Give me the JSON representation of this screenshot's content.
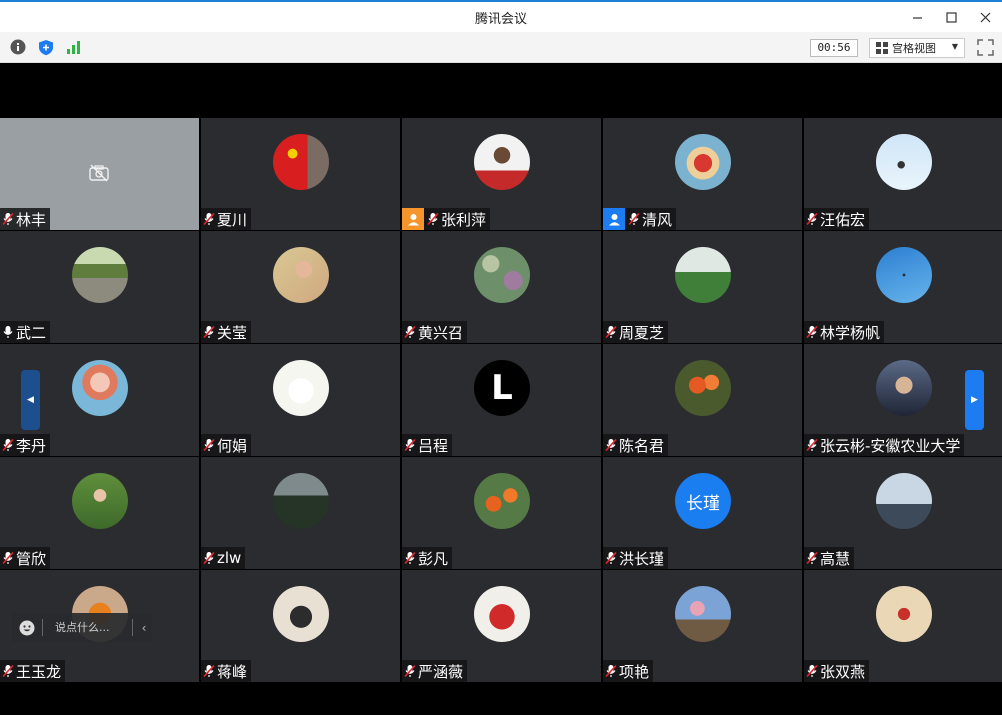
{
  "window": {
    "title": "腾讯会议"
  },
  "toolbar": {
    "icons": [
      "info-icon",
      "shield-icon",
      "signal-icon"
    ],
    "timer": "00:56",
    "view_label": "宫格视图"
  },
  "chat": {
    "placeholder": "说点什么..."
  },
  "participants": [
    {
      "name": "林丰",
      "camera_off": true,
      "mic": "muted"
    },
    {
      "name": "夏川",
      "mic": "muted"
    },
    {
      "name": "张利萍",
      "mic": "muted",
      "badge": "host"
    },
    {
      "name": "清风",
      "mic": "muted",
      "badge": "cohost"
    },
    {
      "name": "汪佑宏",
      "mic": "muted"
    },
    {
      "name": "武二",
      "mic": "on"
    },
    {
      "name": "关莹",
      "mic": "muted"
    },
    {
      "name": "黄兴召",
      "mic": "muted"
    },
    {
      "name": "周夏芝",
      "mic": "muted"
    },
    {
      "name": "林学杨帆",
      "mic": "muted"
    },
    {
      "name": "李丹",
      "mic": "muted"
    },
    {
      "name": "何娟",
      "mic": "muted"
    },
    {
      "name": "吕程",
      "mic": "muted",
      "avatar_text": "L"
    },
    {
      "name": "陈名君",
      "mic": "muted"
    },
    {
      "name": "张云彬-安徽农业大学",
      "mic": "muted"
    },
    {
      "name": "管欣",
      "mic": "muted"
    },
    {
      "name": "zlw",
      "mic": "muted"
    },
    {
      "name": "彭凡",
      "mic": "muted"
    },
    {
      "name": "洪长瑾",
      "mic": "muted",
      "avatar_text": "长瑾"
    },
    {
      "name": "高慧",
      "mic": "muted"
    },
    {
      "name": "王玉龙",
      "mic": "muted"
    },
    {
      "name": "蒋峰",
      "mic": "muted"
    },
    {
      "name": "严涵薇",
      "mic": "muted"
    },
    {
      "name": "项艳",
      "mic": "muted"
    },
    {
      "name": "张双燕",
      "mic": "muted"
    }
  ],
  "colors": {
    "accent": "#1e7cf2",
    "tile_bg": "#2b2c30",
    "host_badge": "#f5952c",
    "cohost_badge": "#1e7cf2"
  }
}
